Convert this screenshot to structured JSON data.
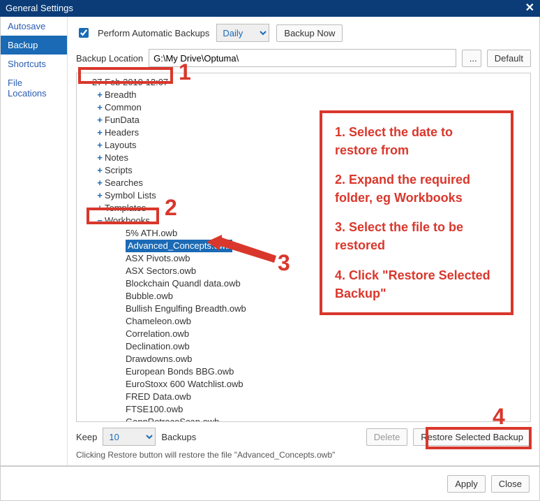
{
  "window": {
    "title": "General Settings",
    "close_glyph": "✕"
  },
  "sidebar": {
    "items": [
      {
        "label": "Autosave",
        "active": false
      },
      {
        "label": "Backup",
        "active": true
      },
      {
        "label": "Shortcuts",
        "active": false
      },
      {
        "label": "File Locations",
        "active": false
      }
    ]
  },
  "toolbar": {
    "perform_label": "Perform Automatic Backups",
    "frequency_value": "Daily",
    "backup_now_label": "Backup Now",
    "location_label": "Backup Location",
    "location_value": "G:\\My Drive\\Optuma\\",
    "browse_label": "...",
    "default_label": "Default"
  },
  "tree": {
    "root": {
      "exp": "−",
      "label": "27 Feb 2019 12:07"
    },
    "folders": [
      {
        "exp": "+",
        "label": "Breadth"
      },
      {
        "exp": "+",
        "label": "Common"
      },
      {
        "exp": "+",
        "label": "FunData"
      },
      {
        "exp": "+",
        "label": "Headers"
      },
      {
        "exp": "+",
        "label": "Layouts"
      },
      {
        "exp": "+",
        "label": "Notes"
      },
      {
        "exp": "+",
        "label": "Scripts"
      },
      {
        "exp": "+",
        "label": "Searches"
      },
      {
        "exp": "+",
        "label": "Symbol Lists"
      },
      {
        "exp": "+",
        "label": "Templates"
      },
      {
        "exp": "−",
        "label": "Workbooks"
      }
    ],
    "files": [
      "5% ATH.owb",
      "Advanced_Concepts.owb",
      "ASX Pivots.owb",
      "ASX Sectors.owb",
      "Blockchain Quandl data.owb",
      "Bubble.owb",
      "Bullish Engulfing Breadth.owb",
      "Chameleon.owb",
      "Correlation.owb",
      "Declination.owb",
      "Drawdowns.owb",
      "European Bonds BBG.owb",
      "EuroStoxx 600 Watchlist.owb",
      "FRED Data.owb",
      "FTSE100.owb",
      "GannRetraceScan.owb"
    ],
    "selected_index": 1
  },
  "bottom": {
    "keep_label": "Keep",
    "keep_value": "10",
    "backups_label": "Backups",
    "delete_label": "Delete",
    "restore_label": "Restore Selected Backup",
    "hint": "Clicking Restore button will restore the file \"Advanced_Concepts.owb\""
  },
  "footer": {
    "apply_label": "Apply",
    "close_label": "Close"
  },
  "annotations": {
    "n1": "1",
    "n2": "2",
    "n3": "3",
    "n4": "4",
    "c1": "1. Select the date to restore from",
    "c2": "2. Expand the required folder, eg Workbooks",
    "c3": "3. Select the file to be restored",
    "c4": "4. Click \"Restore Selected Backup\""
  }
}
